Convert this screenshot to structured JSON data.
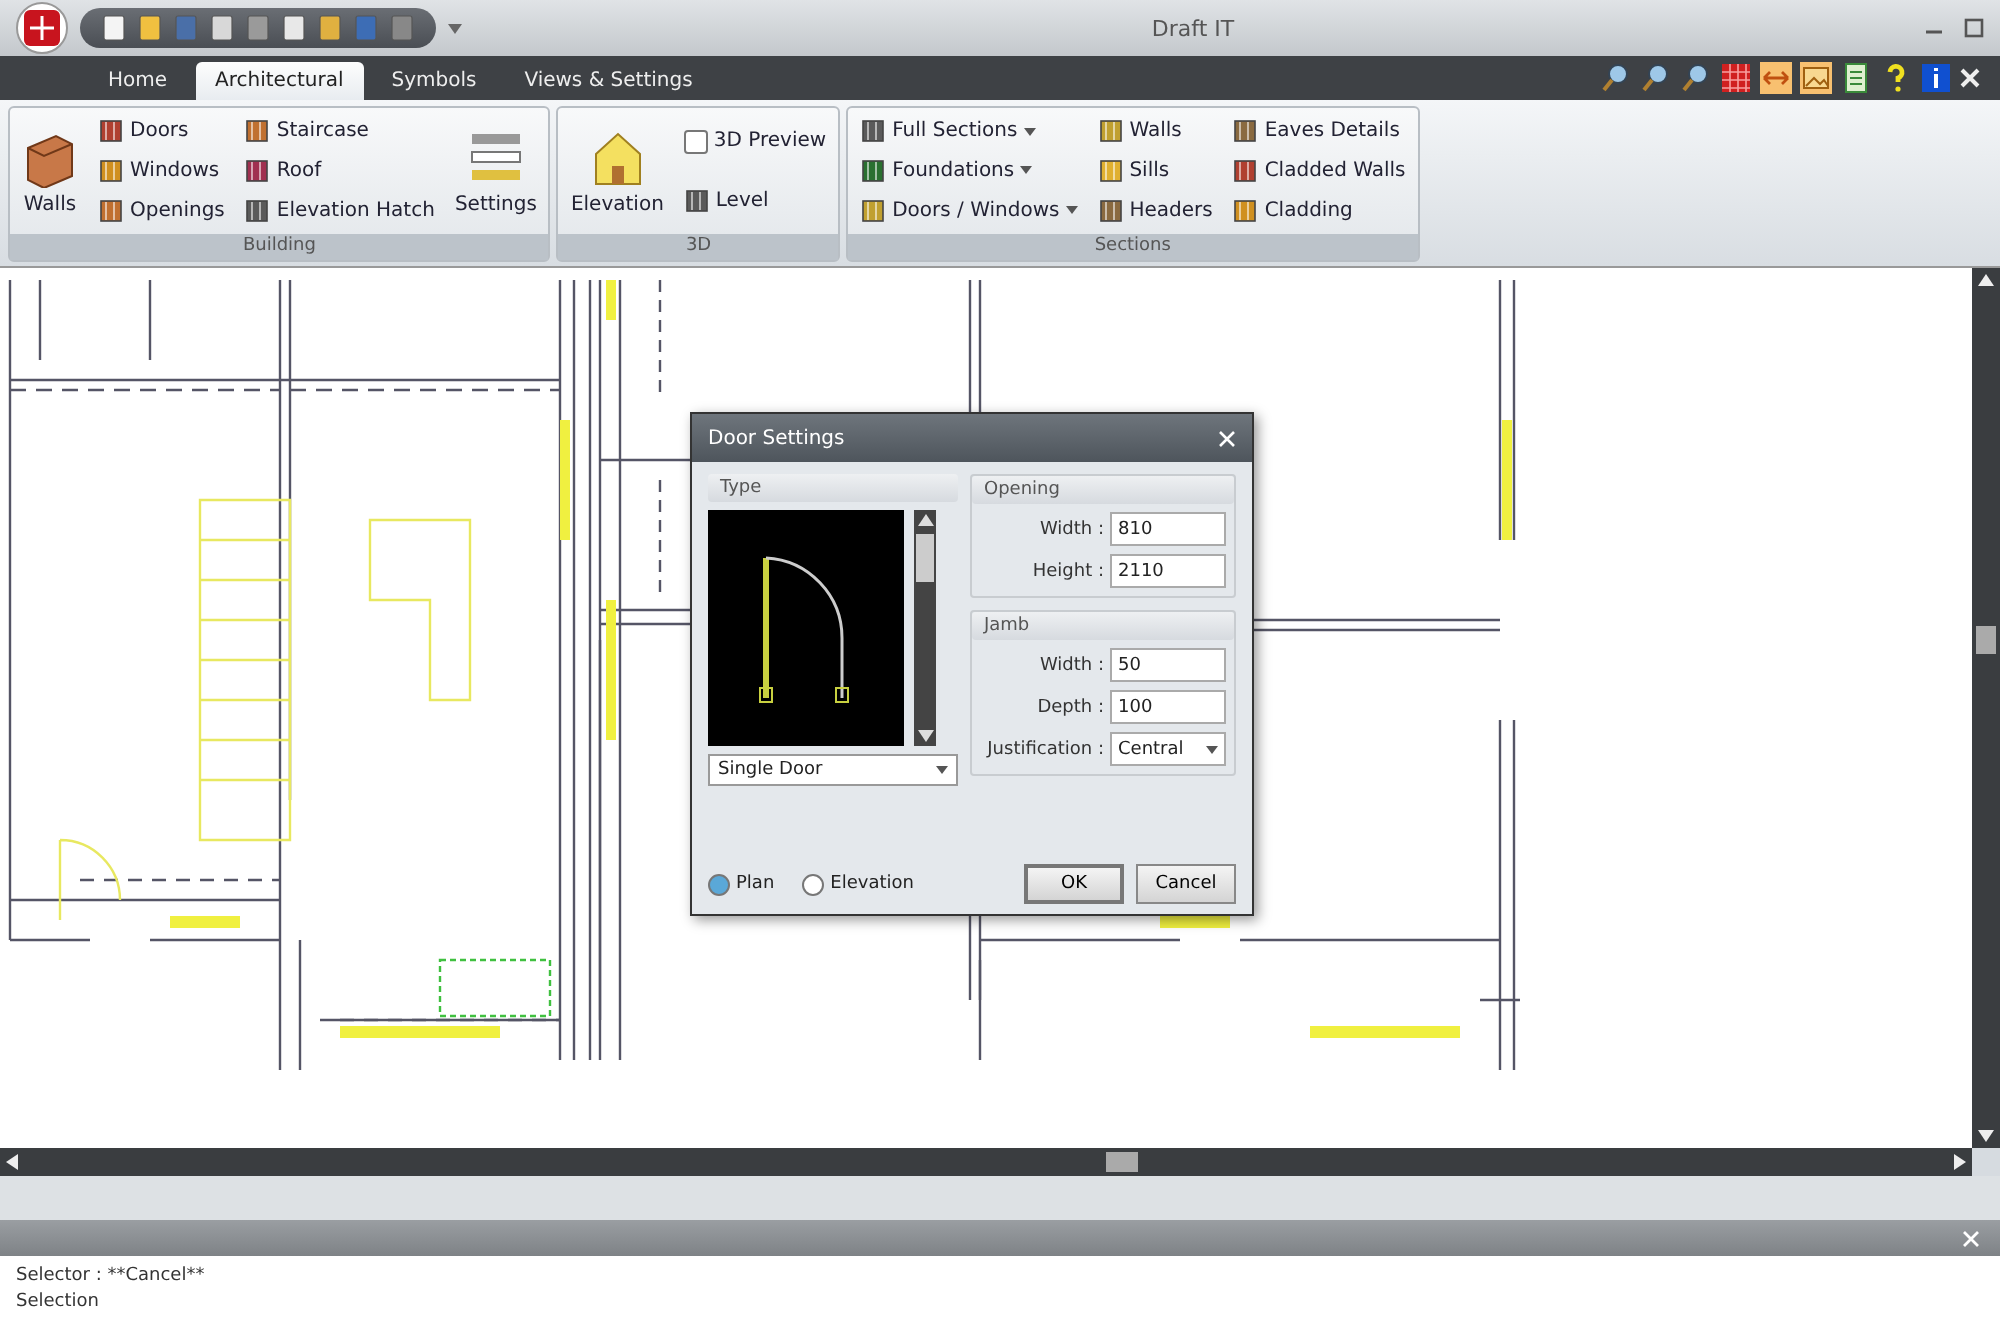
{
  "window": {
    "title": "Draft IT"
  },
  "tabs": [
    {
      "label": "Home",
      "selected": false
    },
    {
      "label": "Architectural",
      "selected": true
    },
    {
      "label": "Symbols",
      "selected": false
    },
    {
      "label": "Views & Settings",
      "selected": false
    }
  ],
  "ribbon": {
    "groups": [
      {
        "title": "Building",
        "columns": [
          [
            {
              "label": "Walls",
              "kind": "large"
            }
          ],
          [
            {
              "label": "Doors",
              "kind": "small"
            },
            {
              "label": "Windows",
              "kind": "small"
            },
            {
              "label": "Openings",
              "kind": "small"
            }
          ],
          [
            {
              "label": "Staircase",
              "kind": "small"
            },
            {
              "label": "Roof",
              "kind": "small"
            },
            {
              "label": "Elevation Hatch",
              "kind": "small"
            }
          ],
          [
            {
              "label": "Settings",
              "kind": "large"
            }
          ]
        ]
      },
      {
        "title": "3D",
        "columns": [
          [
            {
              "label": "Elevation",
              "kind": "large"
            }
          ],
          [
            {
              "label": "3D Preview",
              "kind": "checkbox",
              "checked": false
            },
            {
              "label": "Level",
              "kind": "small"
            }
          ]
        ]
      },
      {
        "title": "Sections",
        "columns": [
          [
            {
              "label": "Full Sections",
              "kind": "dropdown"
            },
            {
              "label": "Foundations",
              "kind": "dropdown"
            },
            {
              "label": "Doors / Windows",
              "kind": "dropdown"
            }
          ],
          [
            {
              "label": "Walls",
              "kind": "small"
            },
            {
              "label": "Sills",
              "kind": "small"
            },
            {
              "label": "Headers",
              "kind": "small"
            }
          ],
          [
            {
              "label": "Eaves Details",
              "kind": "small"
            },
            {
              "label": "Cladded Walls",
              "kind": "small"
            },
            {
              "label": "Cladding",
              "kind": "small"
            }
          ]
        ]
      }
    ]
  },
  "dialog": {
    "title": "Door Settings",
    "type_label": "Type",
    "door_type": "Single Door",
    "sections": [
      {
        "title": "Opening",
        "fields": [
          {
            "label": "Width :",
            "value": "810",
            "kind": "text"
          },
          {
            "label": "Height :",
            "value": "2110",
            "kind": "text"
          }
        ]
      },
      {
        "title": "Jamb",
        "fields": [
          {
            "label": "Width :",
            "value": "50",
            "kind": "text"
          },
          {
            "label": "Depth :",
            "value": "100",
            "kind": "text"
          },
          {
            "label": "Justification :",
            "value": "Central",
            "kind": "select"
          }
        ]
      }
    ],
    "views": [
      {
        "label": "Plan",
        "selected": true
      },
      {
        "label": "Elevation",
        "selected": false
      }
    ],
    "buttons": [
      "OK",
      "Cancel"
    ]
  },
  "command_lines": [
    "Selector : **Cancel**",
    "Selection"
  ]
}
